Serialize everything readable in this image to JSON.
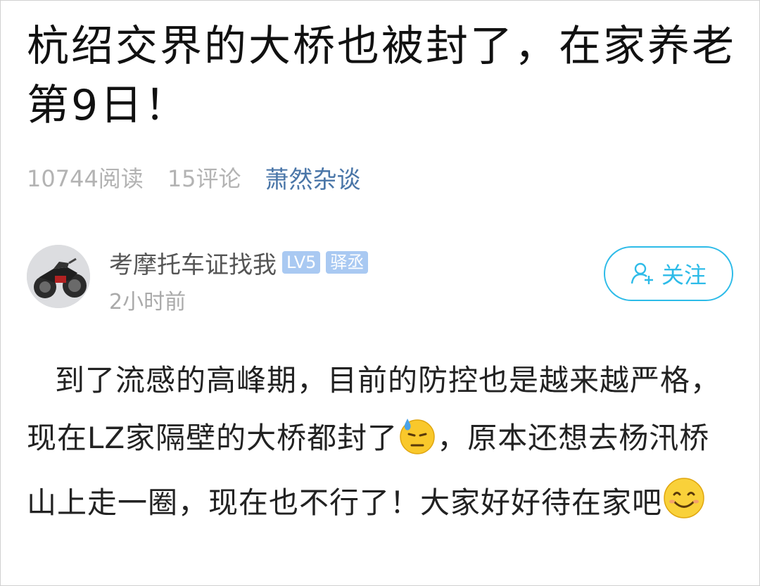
{
  "post": {
    "title": "杭绍交界的大桥也被封了，在家养老第9日！",
    "reads": "10744阅读",
    "comments": "15评论",
    "column": "萧然杂谈"
  },
  "author": {
    "name": "考摩托车证找我",
    "level": "LV5",
    "role": "驿丞",
    "time": "2小时前",
    "follow_label": "关注"
  },
  "content": {
    "text_1": "到了流感的高峰期，目前的防控也是越来越严格，现在LZ家隔壁的大桥都封了",
    "text_2": "，原本还想去杨汛桥山上走一圈，现在也不行了！大家好好待在家吧",
    "emoji_1": "sweat-face-icon",
    "emoji_2": "smile-face-icon"
  }
}
